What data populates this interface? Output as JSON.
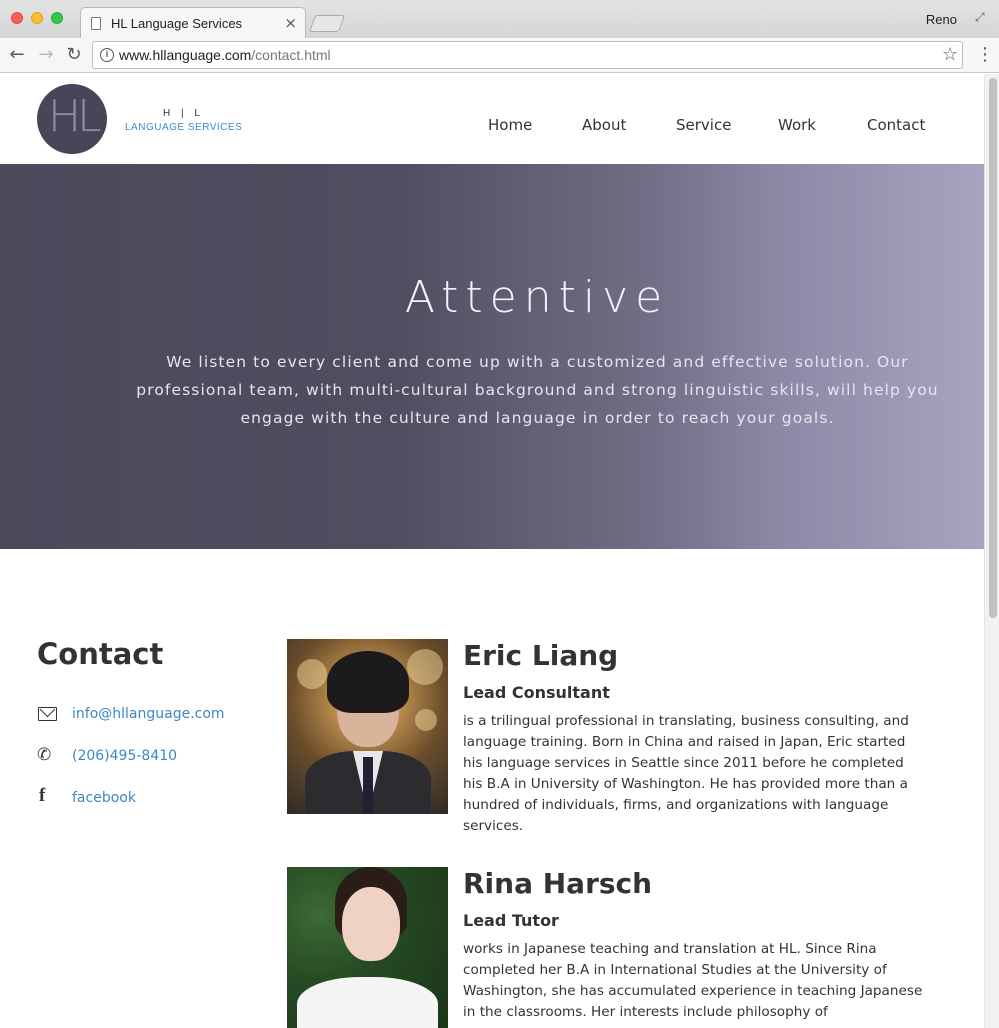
{
  "browser": {
    "tab_title": "HL Language Services",
    "tab_close": "×",
    "profile_name": "Reno",
    "url_domain": "www.hllanguage.com",
    "url_path": "/contact.html"
  },
  "site": {
    "logo_monogram": "HL",
    "logo_top": "H | L",
    "logo_bottom": "LANGUAGE SERVICES",
    "nav": [
      "Home",
      "About",
      "Service",
      "Work",
      "Contact"
    ]
  },
  "hero": {
    "title": "Attentive",
    "text": "We listen to every client and come up with a customized and effective solution. Our professional team, with multi-cultural background and strong linguistic skills, will help you engage with the culture and language in order to reach your goals."
  },
  "contact": {
    "heading": "Contact",
    "email": "info@hllanguage.com",
    "phone": "(206)495-8410",
    "facebook": "facebook"
  },
  "people": [
    {
      "name": "Eric Liang",
      "role": "Lead Consultant",
      "bio": "is a trilingual professional in translating, business consulting, and language training. Born in China and raised in Japan, Eric started his language services in Seattle since 2011 before he completed his B.A in University of Washington. He has provided more than a hundred of individuals, firms, and organizations with language services."
    },
    {
      "name": "Rina Harsch",
      "role": "Lead Tutor",
      "bio": "works in Japanese teaching and translation at HL. Since Rina completed her B.A in International Studies at the University of Washington, she has accumulated experience in teaching Japanese in the classrooms. Her interests include philosophy of"
    }
  ]
}
